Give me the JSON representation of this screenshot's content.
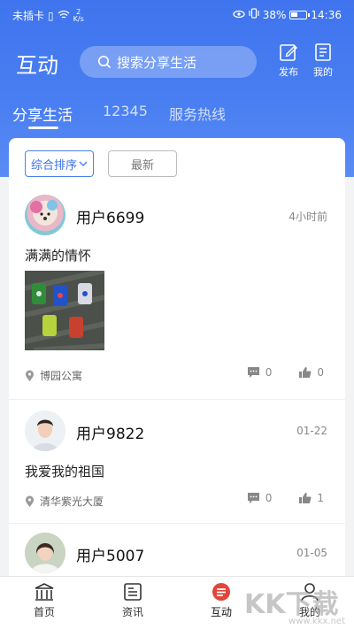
{
  "status_bar": {
    "carrier": "未插卡",
    "net_speed_top": "2",
    "net_speed_unit": "K/s",
    "battery_percent": "38%",
    "battery_level": 0.38,
    "time": "14:36"
  },
  "header": {
    "title": "互动",
    "search_placeholder": "搜索分享生活",
    "publish_label": "发布",
    "mine_label": "我的"
  },
  "tabs": [
    {
      "label": "分享生活",
      "active": true
    },
    {
      "label": "12345",
      "active": false
    },
    {
      "label": "服务热线",
      "active": false
    }
  ],
  "sort": {
    "options": [
      "综合排序",
      "最新"
    ],
    "selected": "综合排序"
  },
  "posts": [
    {
      "user": "用户6699",
      "time": "4小时前",
      "text": "满满的情怀",
      "location": "博园公寓",
      "comments": "0",
      "likes": "0"
    },
    {
      "user": "用户9822",
      "time": "01-22",
      "text": "我爱我的祖国",
      "location": "清华紫光大厦",
      "comments": "0",
      "likes": "1"
    },
    {
      "user": "用户5007",
      "time": "01-05"
    }
  ],
  "bottom_nav": [
    {
      "label": "首页",
      "icon": "home-icon"
    },
    {
      "label": "资讯",
      "icon": "news-icon"
    },
    {
      "label": "互动",
      "icon": "chat-icon",
      "active": true
    },
    {
      "label": "我的",
      "icon": "profile-icon"
    }
  ],
  "watermark": {
    "text": "KK下载",
    "url": "www.kkx.net"
  },
  "colors": {
    "primary": "#4a7ff2",
    "active_tab": "#e2453a"
  }
}
